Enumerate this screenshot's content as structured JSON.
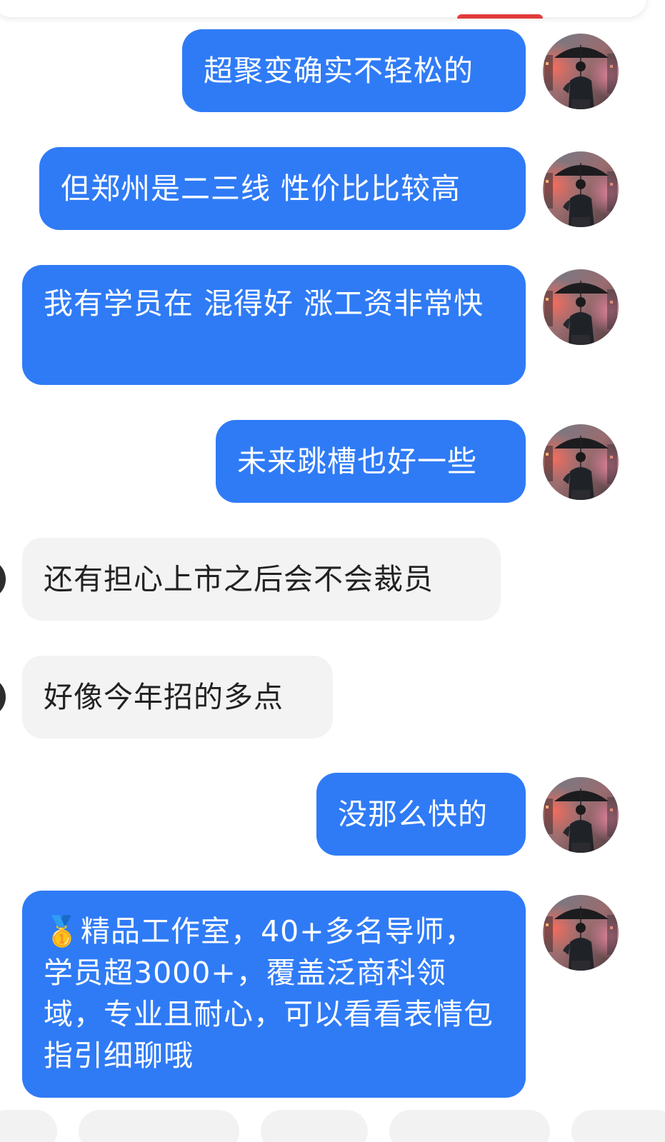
{
  "conversation": {
    "messages": [
      {
        "direction": "out",
        "text": "超聚变确实不轻松的"
      },
      {
        "direction": "out",
        "text": "但郑州是二三线 性价比比较高"
      },
      {
        "direction": "out",
        "text": "我有学员在 混得好 涨工资非常快"
      },
      {
        "direction": "out",
        "text": "未来跳槽也好一些"
      },
      {
        "direction": "in",
        "text": "还有担心上市之后会不会裁员"
      },
      {
        "direction": "in",
        "text": "好像今年招的多点"
      },
      {
        "direction": "out",
        "text": "没那么快的"
      },
      {
        "direction": "out",
        "text": "🥇精品工作室，40+多名导师，学员超3000+，覆盖泛商科领域，专业且耐心，可以看看表情包指引细聊哦"
      }
    ]
  },
  "colors": {
    "outgoing_bubble": "#2f7bf6",
    "incoming_bubble": "#f3f3f4",
    "background": "#ffffff"
  },
  "icons": {
    "user_avatar": "umbrella-man-avatar"
  }
}
